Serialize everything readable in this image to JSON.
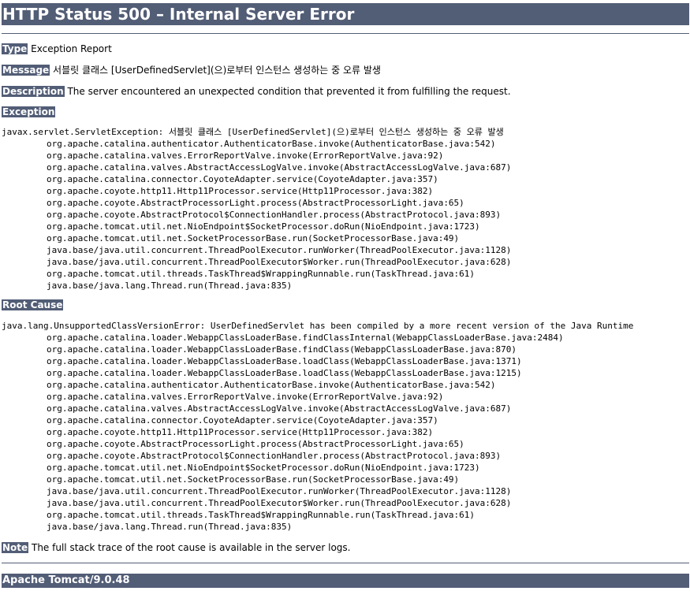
{
  "title": "HTTP Status 500 – Internal Server Error",
  "type": {
    "label": "Type",
    "value": "Exception Report"
  },
  "message": {
    "label": "Message",
    "value": "서블릿 클래스 [UserDefinedServlet](으)로부터 인스턴스 생성하는 중 오류 발생"
  },
  "description": {
    "label": "Description",
    "value": "The server encountered an unexpected condition that prevented it from fulfilling the request."
  },
  "exception": {
    "label": "Exception",
    "first_line": "javax.servlet.ServletException: 서블릿 클래스 [UserDefinedServlet](으)로부터 인스턴스 생성하는 중 오류 발생",
    "frames": [
      "org.apache.catalina.authenticator.AuthenticatorBase.invoke(AuthenticatorBase.java:542)",
      "org.apache.catalina.valves.ErrorReportValve.invoke(ErrorReportValve.java:92)",
      "org.apache.catalina.valves.AbstractAccessLogValve.invoke(AbstractAccessLogValve.java:687)",
      "org.apache.catalina.connector.CoyoteAdapter.service(CoyoteAdapter.java:357)",
      "org.apache.coyote.http11.Http11Processor.service(Http11Processor.java:382)",
      "org.apache.coyote.AbstractProcessorLight.process(AbstractProcessorLight.java:65)",
      "org.apache.coyote.AbstractProtocol$ConnectionHandler.process(AbstractProtocol.java:893)",
      "org.apache.tomcat.util.net.NioEndpoint$SocketProcessor.doRun(NioEndpoint.java:1723)",
      "org.apache.tomcat.util.net.SocketProcessorBase.run(SocketProcessorBase.java:49)",
      "java.base/java.util.concurrent.ThreadPoolExecutor.runWorker(ThreadPoolExecutor.java:1128)",
      "java.base/java.util.concurrent.ThreadPoolExecutor$Worker.run(ThreadPoolExecutor.java:628)",
      "org.apache.tomcat.util.threads.TaskThread$WrappingRunnable.run(TaskThread.java:61)",
      "java.base/java.lang.Thread.run(Thread.java:835)"
    ]
  },
  "root_cause": {
    "label": "Root Cause",
    "first_line": "java.lang.UnsupportedClassVersionError: UserDefinedServlet has been compiled by a more recent version of the Java Runtime",
    "frames": [
      "org.apache.catalina.loader.WebappClassLoaderBase.findClassInternal(WebappClassLoaderBase.java:2484)",
      "org.apache.catalina.loader.WebappClassLoaderBase.findClass(WebappClassLoaderBase.java:870)",
      "org.apache.catalina.loader.WebappClassLoaderBase.loadClass(WebappClassLoaderBase.java:1371)",
      "org.apache.catalina.loader.WebappClassLoaderBase.loadClass(WebappClassLoaderBase.java:1215)",
      "org.apache.catalina.authenticator.AuthenticatorBase.invoke(AuthenticatorBase.java:542)",
      "org.apache.catalina.valves.ErrorReportValve.invoke(ErrorReportValve.java:92)",
      "org.apache.catalina.valves.AbstractAccessLogValve.invoke(AbstractAccessLogValve.java:687)",
      "org.apache.catalina.connector.CoyoteAdapter.service(CoyoteAdapter.java:357)",
      "org.apache.coyote.http11.Http11Processor.service(Http11Processor.java:382)",
      "org.apache.coyote.AbstractProcessorLight.process(AbstractProcessorLight.java:65)",
      "org.apache.coyote.AbstractProtocol$ConnectionHandler.process(AbstractProtocol.java:893)",
      "org.apache.tomcat.util.net.NioEndpoint$SocketProcessor.doRun(NioEndpoint.java:1723)",
      "org.apache.tomcat.util.net.SocketProcessorBase.run(SocketProcessorBase.java:49)",
      "java.base/java.util.concurrent.ThreadPoolExecutor.runWorker(ThreadPoolExecutor.java:1128)",
      "java.base/java.util.concurrent.ThreadPoolExecutor$Worker.run(ThreadPoolExecutor.java:628)",
      "org.apache.tomcat.util.threads.TaskThread$WrappingRunnable.run(TaskThread.java:61)",
      "java.base/java.lang.Thread.run(Thread.java:835)"
    ]
  },
  "note": {
    "label": "Note",
    "value": "The full stack trace of the root cause is available in the server logs."
  },
  "footer": "Apache Tomcat/9.0.48",
  "colors": {
    "header_bg": "#525d76",
    "header_text": "#ffffff"
  }
}
